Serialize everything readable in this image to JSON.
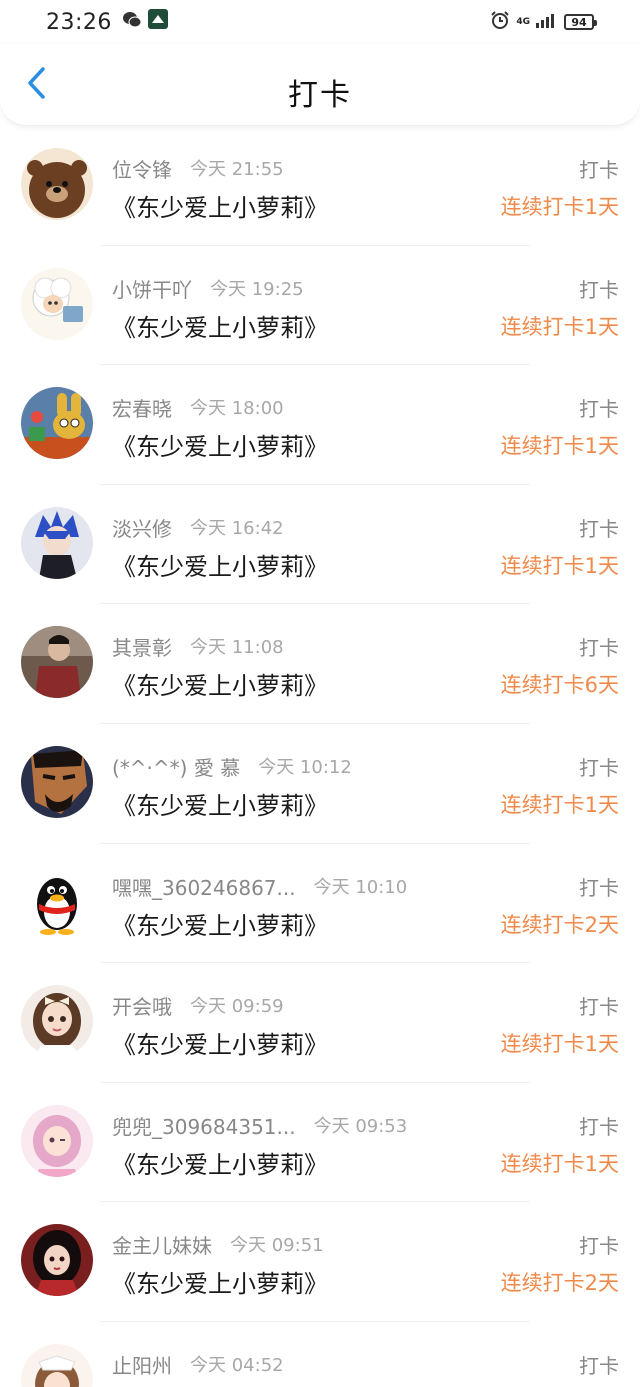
{
  "status_bar": {
    "time": "23:26",
    "battery": "94",
    "network": "4G"
  },
  "header": {
    "title": "打卡"
  },
  "colors": {
    "accent_blue": "#2a8fe3",
    "streak_orange": "#f08a4b"
  },
  "items": [
    {
      "name": "位令锋",
      "time": "今天 21:55",
      "book": "《东少爱上小萝莉》",
      "action": "打卡",
      "streak": "连续打卡1天",
      "avatar_icon": "bear-avatar-icon"
    },
    {
      "name": "小饼干吖",
      "time": "今天 19:25",
      "book": "《东少爱上小萝莉》",
      "action": "打卡",
      "streak": "连续打卡1天",
      "avatar_icon": "sheep-avatar-icon"
    },
    {
      "name": "宏春晓",
      "time": "今天 18:00",
      "book": "《东少爱上小萝莉》",
      "action": "打卡",
      "streak": "连续打卡1天",
      "avatar_icon": "cartoon-avatar-icon"
    },
    {
      "name": "淡兴修",
      "time": "今天 16:42",
      "book": "《东少爱上小萝莉》",
      "action": "打卡",
      "streak": "连续打卡1天",
      "avatar_icon": "anime-avatar-icon"
    },
    {
      "name": "其景彰",
      "time": "今天 11:08",
      "book": "《东少爱上小萝莉》",
      "action": "打卡",
      "streak": "连续打卡6天",
      "avatar_icon": "photo-avatar-icon"
    },
    {
      "name": "(*^·^*) 愛 慕",
      "time": "今天 10:12",
      "book": "《东少爱上小萝莉》",
      "action": "打卡",
      "streak": "连续打卡1天",
      "avatar_icon": "warrior-avatar-icon"
    },
    {
      "name": "嘿嘿_360246867...",
      "time": "今天 10:10",
      "book": "《东少爱上小萝莉》",
      "action": "打卡",
      "streak": "连续打卡2天",
      "avatar_icon": "penguin-avatar-icon"
    },
    {
      "name": "开会哦",
      "time": "今天 09:59",
      "book": "《东少爱上小萝莉》",
      "action": "打卡",
      "streak": "连续打卡1天",
      "avatar_icon": "doll-avatar-icon"
    },
    {
      "name": "兜兜_309684351...",
      "time": "今天 09:53",
      "book": "《东少爱上小萝莉》",
      "action": "打卡",
      "streak": "连续打卡1天",
      "avatar_icon": "pink-girl-avatar-icon"
    },
    {
      "name": "金主儿妹妹",
      "time": "今天 09:51",
      "book": "《东少爱上小萝莉》",
      "action": "打卡",
      "streak": "连续打卡2天",
      "avatar_icon": "dark-girl-avatar-icon"
    },
    {
      "name": "止阳州",
      "time": "今天 04:52",
      "book": "",
      "action": "打卡",
      "streak": "",
      "avatar_icon": "girl-avatar-icon"
    }
  ]
}
